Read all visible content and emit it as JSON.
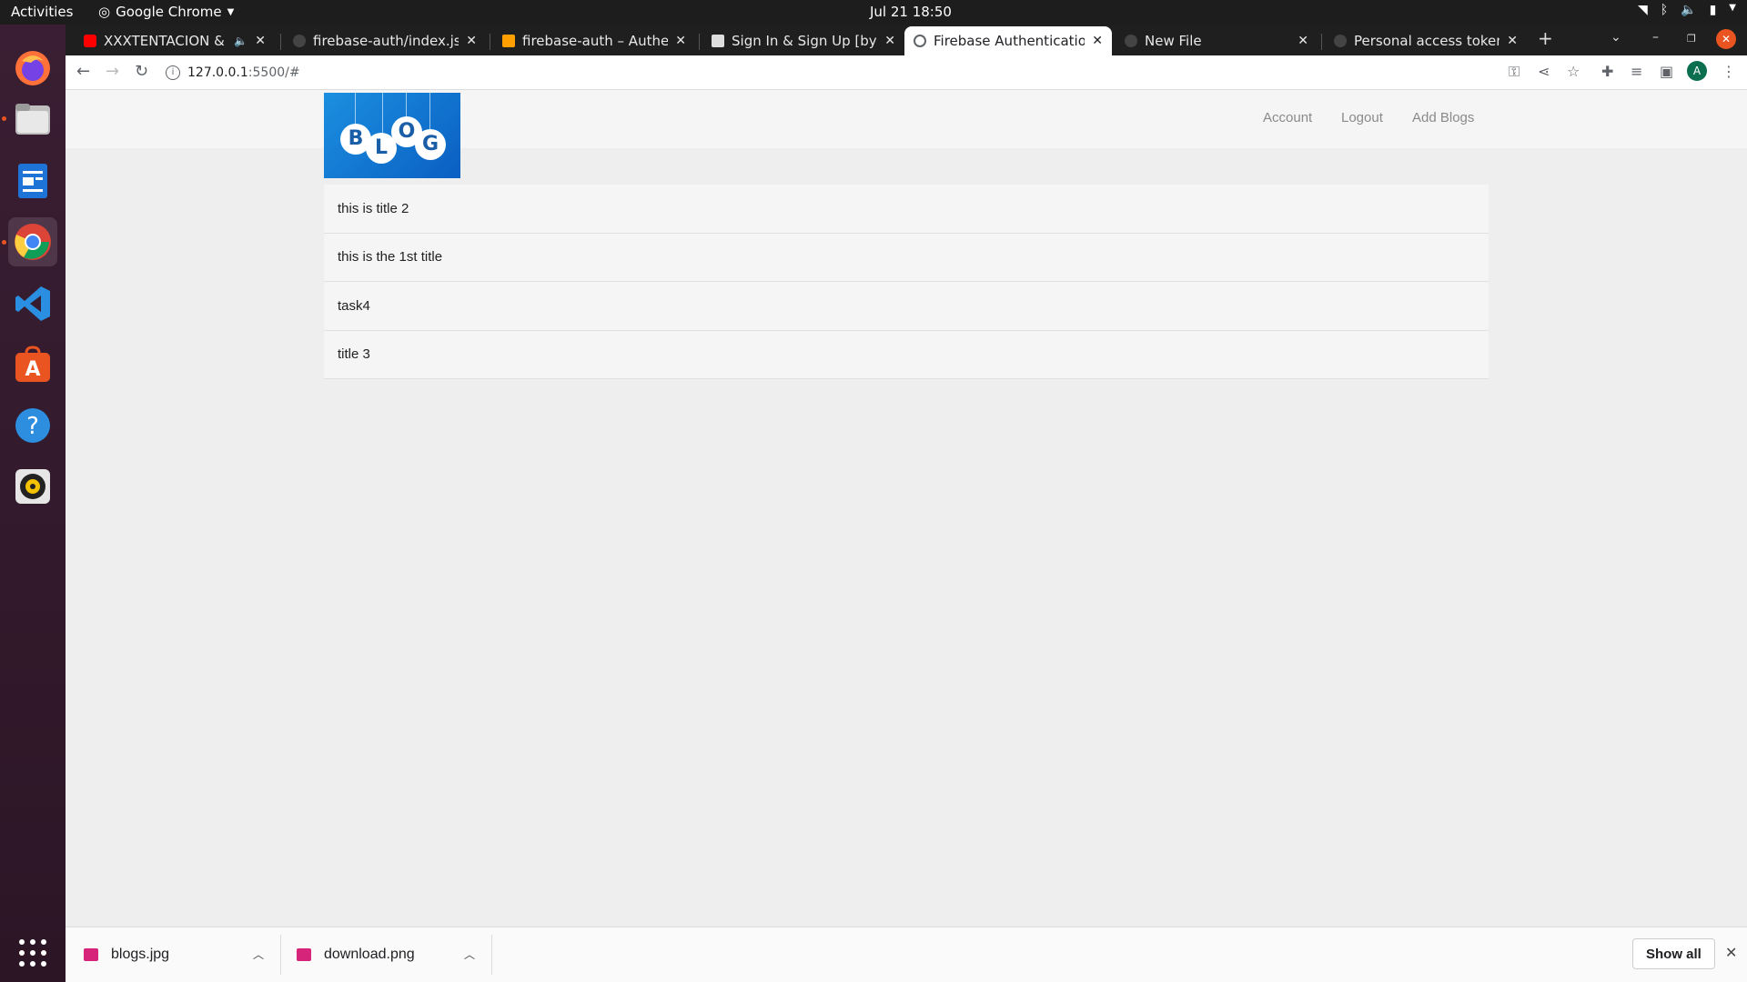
{
  "topbar": {
    "activities": "Activities",
    "app_name": "Google Chrome",
    "clock": "Jul 21  18:50"
  },
  "tabs": [
    {
      "title": "XXXTENTACION & Li",
      "fav_color": "#ff0000"
    },
    {
      "title": "firebase-auth/index.js a",
      "fav_color": "#444444"
    },
    {
      "title": "firebase-auth – Authent",
      "fav_color": "#ffa000"
    },
    {
      "title": "Sign In & Sign Up [by Bo",
      "fav_color": "#dddddd"
    },
    {
      "title": "Firebase Authentication",
      "fav_color": "#5f6368"
    },
    {
      "title": "New File",
      "fav_color": "#444444"
    },
    {
      "title": "Personal access tokens",
      "fav_color": "#444444"
    }
  ],
  "address": {
    "host": "127.0.0.1",
    "path": ":5500/#"
  },
  "profile_initial": "A",
  "navbar": {
    "links": [
      "Account",
      "Logout",
      "Add Blogs"
    ]
  },
  "logo_letters": [
    "B",
    "L",
    "O",
    "G"
  ],
  "blogs": [
    "this is title 2",
    "this is the 1st title",
    "task4",
    "title 3"
  ],
  "downloads": {
    "items": [
      "blogs.jpg",
      "download.png"
    ],
    "show_all": "Show all"
  }
}
